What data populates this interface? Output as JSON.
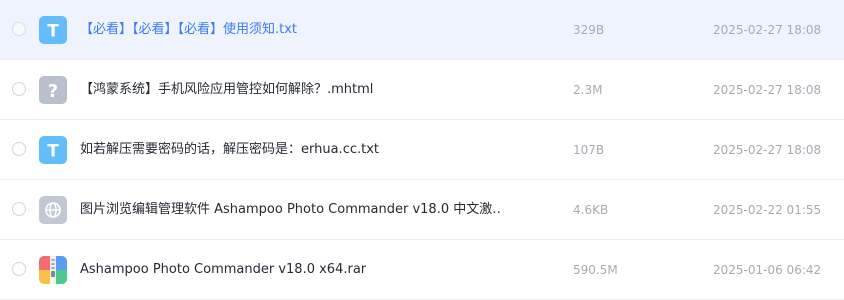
{
  "files": [
    {
      "name": "【必看】【必看】【必看】使用须知.txt",
      "size": "329B",
      "date": "2025-02-27 18:08",
      "icon": "text-file-icon",
      "selected": true
    },
    {
      "name": "【鸿蒙系统】手机风险应用管控如何解除？.mhtml",
      "size": "2.3M",
      "date": "2025-02-27 18:08",
      "icon": "unknown-file-icon",
      "selected": false
    },
    {
      "name": "如若解压需要密码的话，解压密码是：erhua.cc.txt",
      "size": "107B",
      "date": "2025-02-27 18:08",
      "icon": "text-file-icon",
      "selected": false
    },
    {
      "name": "图片浏览编辑管理软件 Ashampoo Photo Commander v18.0 中文激…",
      "size": "4.6KB",
      "date": "2025-02-22 01:55",
      "icon": "web-link-icon",
      "selected": false
    },
    {
      "name": "Ashampoo Photo Commander v18.0 x64.rar",
      "size": "590.5M",
      "date": "2025-01-06 06:42",
      "icon": "archive-file-icon",
      "selected": false
    }
  ],
  "colors": {
    "selected_row_bg": "#eef3fe",
    "selected_text": "#3b7cf0",
    "text_icon_blue": "#62bdfa",
    "unknown_icon_gray": "#b9bfcc",
    "web_icon_gray": "#c2c8d3",
    "meta_text": "#a6abb3"
  }
}
